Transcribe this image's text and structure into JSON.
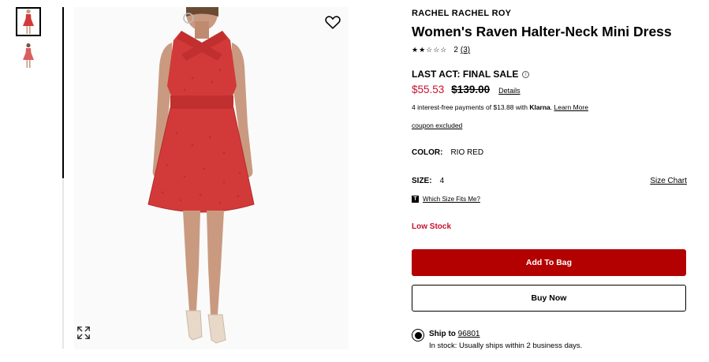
{
  "thumbnails": [
    {
      "name": "front view",
      "selected": true
    },
    {
      "name": "back view",
      "selected": false
    }
  ],
  "product": {
    "brand": "RACHEL RACHEL ROY",
    "title": "Women's Raven Halter-Neck Mini Dress",
    "rating_stars": "★★☆☆☆",
    "rating_value": "2",
    "rating_count_link": "(3)",
    "sale_label": "LAST ACT: FINAL SALE",
    "info_icon": "i",
    "sale_price": "$55.53",
    "original_price": "$139.00",
    "details_link": "Details",
    "klarna_prefix": "4 interest-free payments of $13.88 with ",
    "klarna_brand": "Klarna",
    "klarna_link": "Learn More",
    "coupon": "coupon excluded",
    "color_label": "COLOR:",
    "color_value": "RIO RED",
    "size_label": "SIZE:",
    "size_value": "4",
    "size_chart": "Size Chart",
    "fit_icon": "T",
    "fit_link": "Which Size Fits Me?",
    "stock_status": "Low Stock",
    "add_to_bag": "Add To Bag",
    "buy_now": "Buy Now",
    "ship_to": "Ship to",
    "zip": "96801",
    "ship_status": "In stock: Usually ships within 2 business days."
  },
  "colors": {
    "sale_red": "#c8102e",
    "button_red": "#b30000",
    "dress_red": "#d23a3a"
  },
  "icons": {
    "favorite": "heart-icon",
    "zoom": "expand-icon"
  }
}
